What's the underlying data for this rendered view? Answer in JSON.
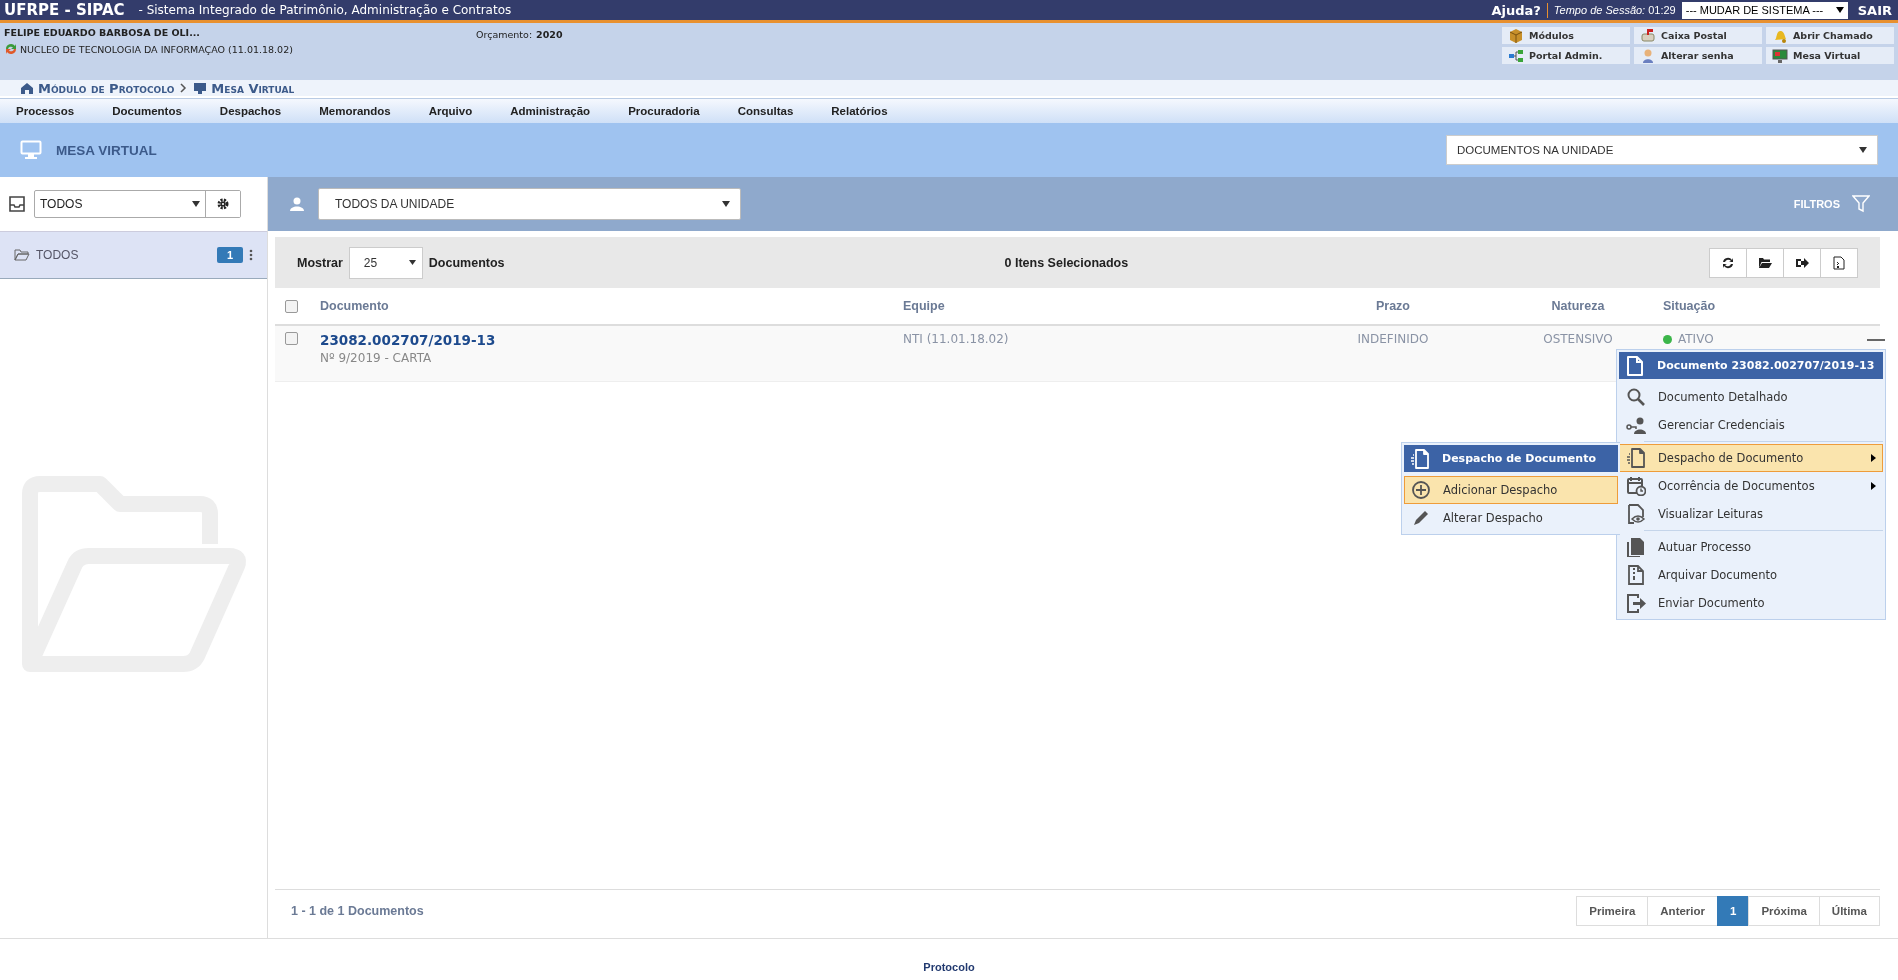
{
  "top_bar": {
    "system_title": "UFRPE - SIPAC",
    "subtitle": "- Sistema Integrado de Patrimônio, Administração e Contratos",
    "help": "Ajuda?",
    "session_label": "Tempo de Sessão:",
    "session_time": "01:29",
    "system_select": "--- MUDAR DE SISTEMA ---",
    "logout": "SAIR"
  },
  "user_info": {
    "name": "FELIPE EDUARDO BARBOSA DE OLI...",
    "unit": "NUCLEO DE TECNOLOGIA DA INFORMAÇAO (11.01.18.02)",
    "budget_label": "Orçamento:",
    "budget_year": "2020"
  },
  "shortcuts": [
    {
      "label": "Módulos"
    },
    {
      "label": "Caixa Postal"
    },
    {
      "label": "Abrir Chamado"
    },
    {
      "label": "Portal Admin."
    },
    {
      "label": "Alterar senha"
    },
    {
      "label": "Mesa Virtual"
    }
  ],
  "breadcrumb": [
    {
      "label": "Módulo de Protocolo"
    },
    {
      "label": "Mesa Virtual"
    }
  ],
  "main_menu": [
    "Processos",
    "Documentos",
    "Despachos",
    "Memorandos",
    "Arquivo",
    "Administração",
    "Procuradoria",
    "Consultas",
    "Relatórios"
  ],
  "page_header": {
    "title": "MESA VIRTUAL",
    "view_select": "DOCUMENTOS NA UNIDADE"
  },
  "sidebar": {
    "box_select": "TODOS",
    "folders": [
      {
        "label": "TODOS",
        "count": "1",
        "selected": true
      }
    ]
  },
  "filter_bar": {
    "user_select": "TODOS DA UNIDADE",
    "filters": "FILTROS"
  },
  "toolbar": {
    "show_label": "Mostrar",
    "page_size": "25",
    "documents_label": "Documentos",
    "selection_count": "0 Itens Selecionados"
  },
  "table": {
    "select_all_checked": false,
    "columns": [
      "Documento",
      "Equipe",
      "Prazo",
      "Natureza",
      "Situação"
    ],
    "rows": [
      {
        "checked": false,
        "number": "23082.002707/2019-13",
        "description": "Nº 9/2019 - CARTA",
        "team": "NTI (11.01.18.02)",
        "deadline": "INDEFINIDO",
        "nature": "OSTENSIVO",
        "status": "ATIVO",
        "color": "#3cb64a"
      }
    ]
  },
  "context_menu": {
    "title": "Documento 23082.002707/2019-13",
    "groups": [
      [
        {
          "label": "Documento Detalhado",
          "selected": false,
          "has_submenu": false
        },
        {
          "label": "Gerenciar Credenciais",
          "selected": false,
          "has_submenu": false
        }
      ],
      [
        {
          "label": "Despacho de Documento",
          "selected": true,
          "has_submenu": true
        },
        {
          "label": "Ocorrência de Documentos",
          "selected": false,
          "has_submenu": true
        },
        {
          "label": "Visualizar Leituras",
          "selected": false,
          "has_submenu": false
        }
      ],
      [
        {
          "label": "Autuar Processo",
          "selected": false,
          "has_submenu": false
        },
        {
          "label": "Arquivar Documento",
          "selected": false,
          "has_submenu": false
        },
        {
          "label": "Enviar Documento",
          "selected": false,
          "has_submenu": false
        }
      ]
    ]
  },
  "submenu": {
    "title": "Despacho de Documento",
    "items": [
      {
        "label": "Adicionar Despacho",
        "selected": true
      },
      {
        "label": "Alterar Despacho",
        "selected": false
      }
    ]
  },
  "pagination": {
    "summary": "1 - 1 de 1 Documentos",
    "pages": [
      {
        "label": "Primeira",
        "selected": false
      },
      {
        "label": "Anterior",
        "selected": false
      },
      {
        "label": "1",
        "selected": true
      },
      {
        "label": "Próxima",
        "selected": false
      },
      {
        "label": "Última",
        "selected": false
      }
    ]
  },
  "footer": {
    "text": "Protocolo"
  }
}
